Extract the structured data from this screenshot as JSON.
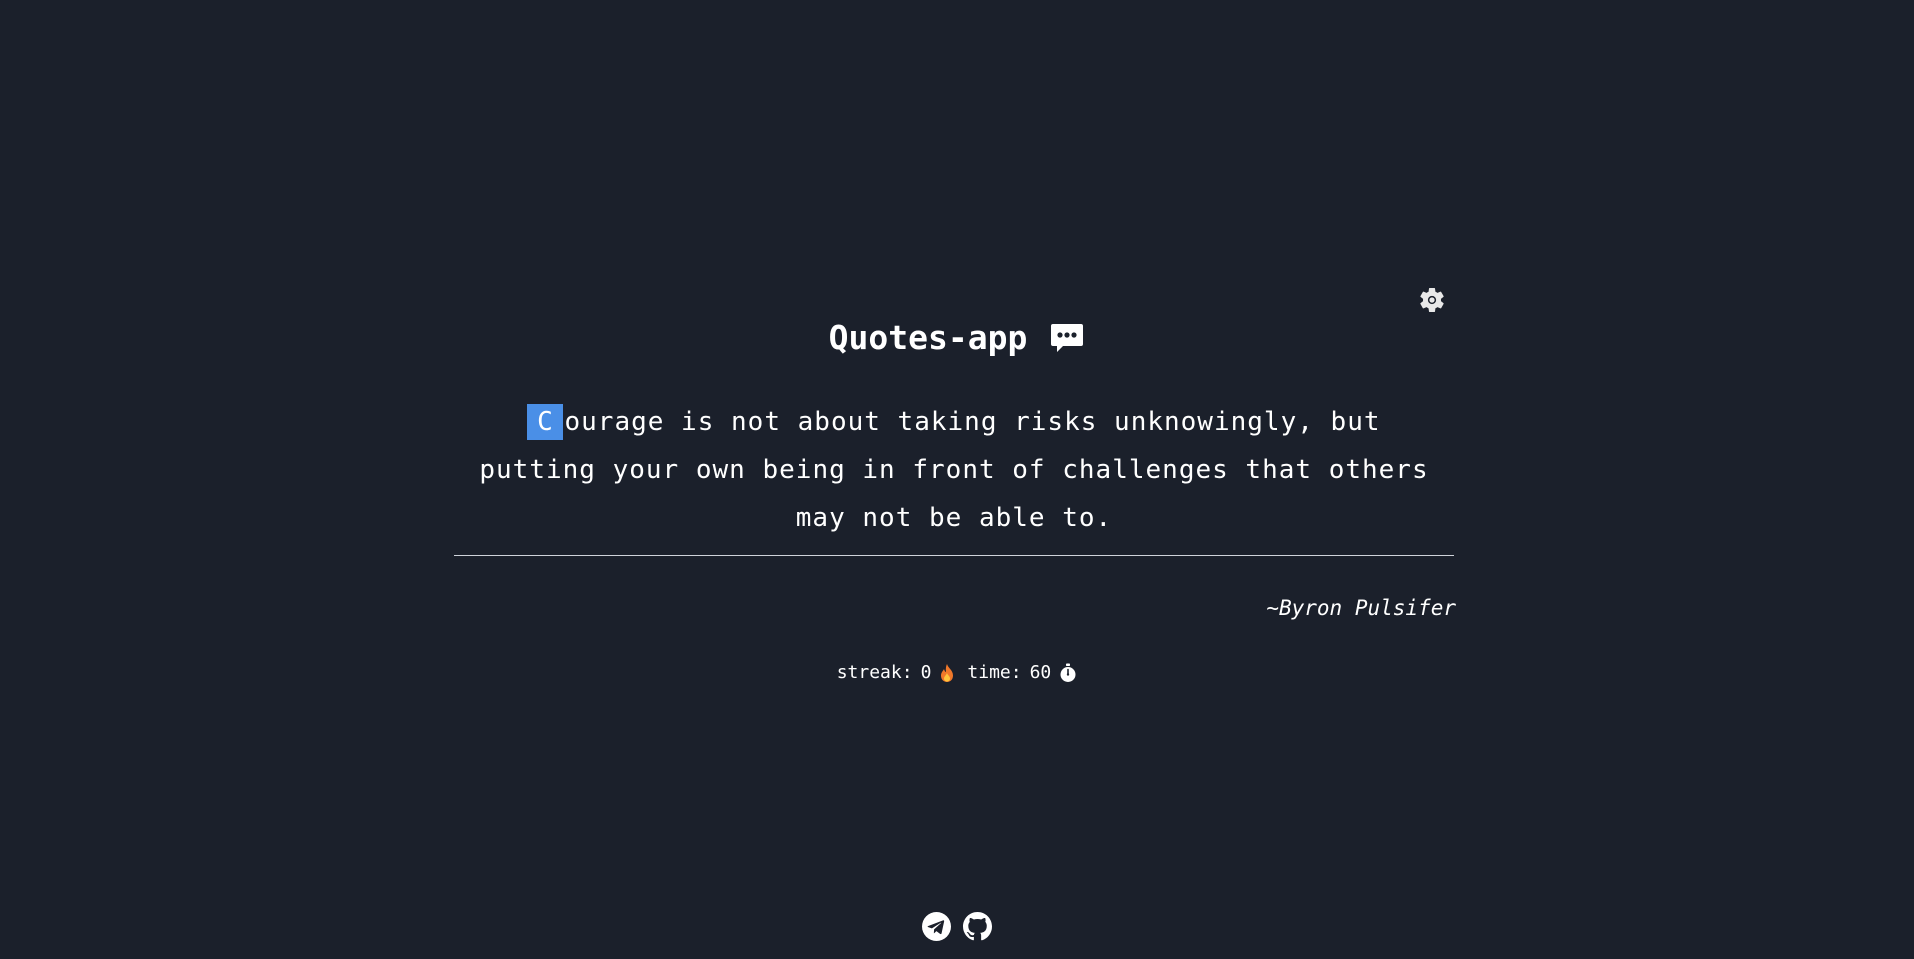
{
  "app": {
    "title": "Quotes-app"
  },
  "quote": {
    "current_char": "C",
    "remaining_text": "ourage is not about taking risks unknowingly, but putting your own being in front of challenges that others may not be able to.",
    "author": "~Byron Pulsifer"
  },
  "stats": {
    "streak_label": "streak:",
    "streak_value": "0",
    "time_label": "time:",
    "time_value": "60"
  },
  "icons": {
    "settings": "gear-icon",
    "title_icon": "speech-bubble-icon",
    "streak_icon": "fire-icon",
    "time_icon": "stopwatch-icon",
    "footer": [
      "telegram-icon",
      "github-icon"
    ]
  },
  "colors": {
    "background": "#1b202b",
    "text": "#ffffff",
    "cursor_highlight": "#4a8fe7"
  }
}
